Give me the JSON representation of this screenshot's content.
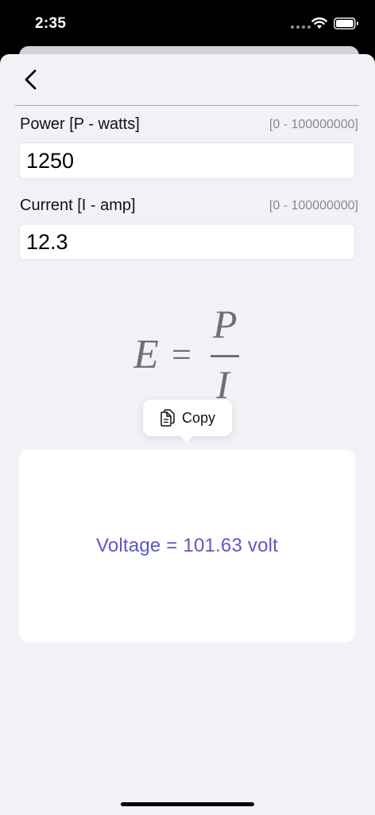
{
  "status_bar": {
    "time": "2:35"
  },
  "icons": {
    "back": "chevron-left-icon",
    "wifi": "wifi-icon",
    "battery": "battery-icon",
    "copy": "copy-icon"
  },
  "fields": [
    {
      "label": "Power [P - watts]",
      "range": "[0 - 100000000]",
      "value": "1250"
    },
    {
      "label": "Current [I - amp]",
      "range": "[0 - 100000000]",
      "value": "12.3"
    }
  ],
  "formula": {
    "lhs": "E",
    "equals": "=",
    "numerator": "P",
    "denominator": "I"
  },
  "copy_menu": {
    "label": "Copy"
  },
  "result": {
    "text": "Voltage = 101.63 volt"
  },
  "colors": {
    "background": "#f2f1f6",
    "result_accent": "#5b57c9",
    "range_text": "#8a8a8e"
  }
}
